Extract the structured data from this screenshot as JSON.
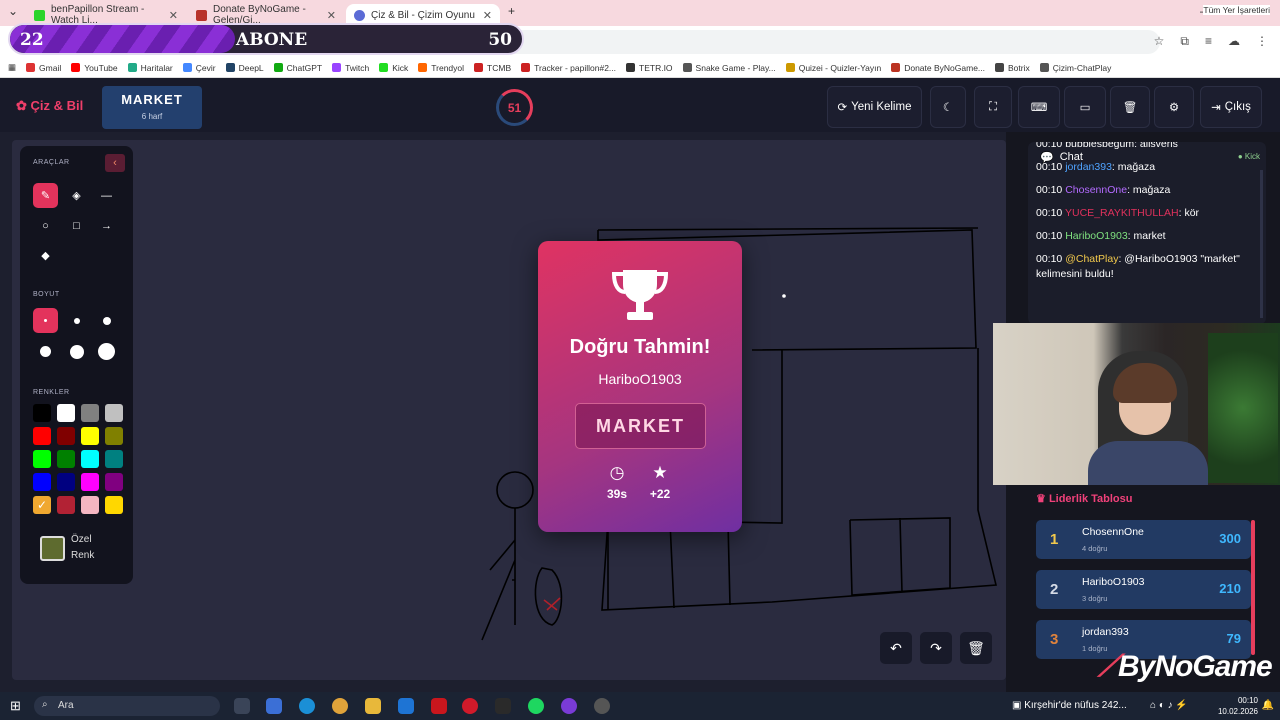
{
  "browser": {
    "tabs": [
      {
        "title": "benPapillon Stream - Watch Li...",
        "color": "#2bd42b"
      },
      {
        "title": "Donate ByNoGame - Gelen/Gi...",
        "color": "#b8322a"
      },
      {
        "title": "Çiz & Bil - Çizim Oyunu",
        "color": "#5b6bd6"
      }
    ],
    "bookmarks": [
      "Gmail",
      "YouTube",
      "Haritalar",
      "Çevir",
      "DeepL",
      "ChatGPT",
      "Twitch",
      "Kick",
      "Trendyol",
      "TCMB",
      "Tracker - papillon#2...",
      "TETR.IO",
      "Snake Game - Play...",
      "Quizei - Quizler-Yayın",
      "Donate ByNoGame...",
      "Botrix",
      "Çizim-ChatPlay"
    ],
    "bookmarks_right": "Tüm Yer İşaretleri"
  },
  "sub_goal": {
    "current": "22",
    "label": "ABONE",
    "target": "50",
    "progress_fraction": 0.44
  },
  "header": {
    "brand": "Çiz & Bil",
    "word": "MARKET",
    "word_hint": "6 harf",
    "timer": "51",
    "new_word_label": "Yeni Kelime",
    "exit_label": "Çıkış"
  },
  "tools": {
    "tools_title": "ARAÇLAR",
    "size_title": "BOYUT",
    "colors_title": "RENKLER",
    "custom_label_1": "Özel",
    "custom_label_2": "Renk",
    "palette": [
      "#000000",
      "#ffffff",
      "#808080",
      "#c0c0c0",
      "#ff0000",
      "#800000",
      "#ffff00",
      "#808000",
      "#00ff00",
      "#008000",
      "#00ffff",
      "#008080",
      "#0000ff",
      "#000080",
      "#ff00ff",
      "#800080",
      "#f0a830",
      "#b22234",
      "#f4b6c2",
      "#ffd700"
    ],
    "custom_color": "#5e6b2f"
  },
  "result": {
    "title": "Doğru Tahmin!",
    "user": "HariboO1903",
    "word": "MARKET",
    "time": "39s",
    "points": "+22"
  },
  "chat": {
    "title": "Chat",
    "platform": "Kick",
    "messages": [
      {
        "time": "00:10",
        "user": "bubblesbegum",
        "text": ": alisveris",
        "color": "#ffffff"
      },
      {
        "time": "00:10",
        "user": "jordan393",
        "text": ": mağaza",
        "color": "#4fa3ff"
      },
      {
        "time": "00:10",
        "user": "ChosennOne",
        "text": ": mağaza",
        "color": "#b36bff"
      },
      {
        "time": "00:10",
        "user": "YUCE_RAYKITHULLAH",
        "text": ": kör",
        "color": "#e0315c"
      },
      {
        "time": "00:10",
        "user": "HariboO1903",
        "text": ": market",
        "color": "#7fe07f"
      },
      {
        "time": "00:10",
        "user": "@ChatPlay",
        "text": ": @HariboO1903 \"market\" kelimesini buldu!",
        "color": "#f2c94c"
      }
    ]
  },
  "leaderboard": {
    "title": "Liderlik Tablosu",
    "rows": [
      {
        "rank": "1",
        "name": "ChosennOne",
        "sub": "4 doğru",
        "score": "300",
        "color": "#f2c94c"
      },
      {
        "rank": "2",
        "name": "HariboO1903",
        "sub": "3 doğru",
        "score": "210",
        "color": "#d6dbe6"
      },
      {
        "rank": "3",
        "name": "jordan393",
        "sub": "1 doğru",
        "score": "79",
        "color": "#e0833c"
      }
    ]
  },
  "overlay_brand": "ByNoGame",
  "taskbar": {
    "search_placeholder": "Ara",
    "news": "Kırşehir'de nüfus 242...",
    "time": "00:10",
    "date": "10.02.2026"
  }
}
